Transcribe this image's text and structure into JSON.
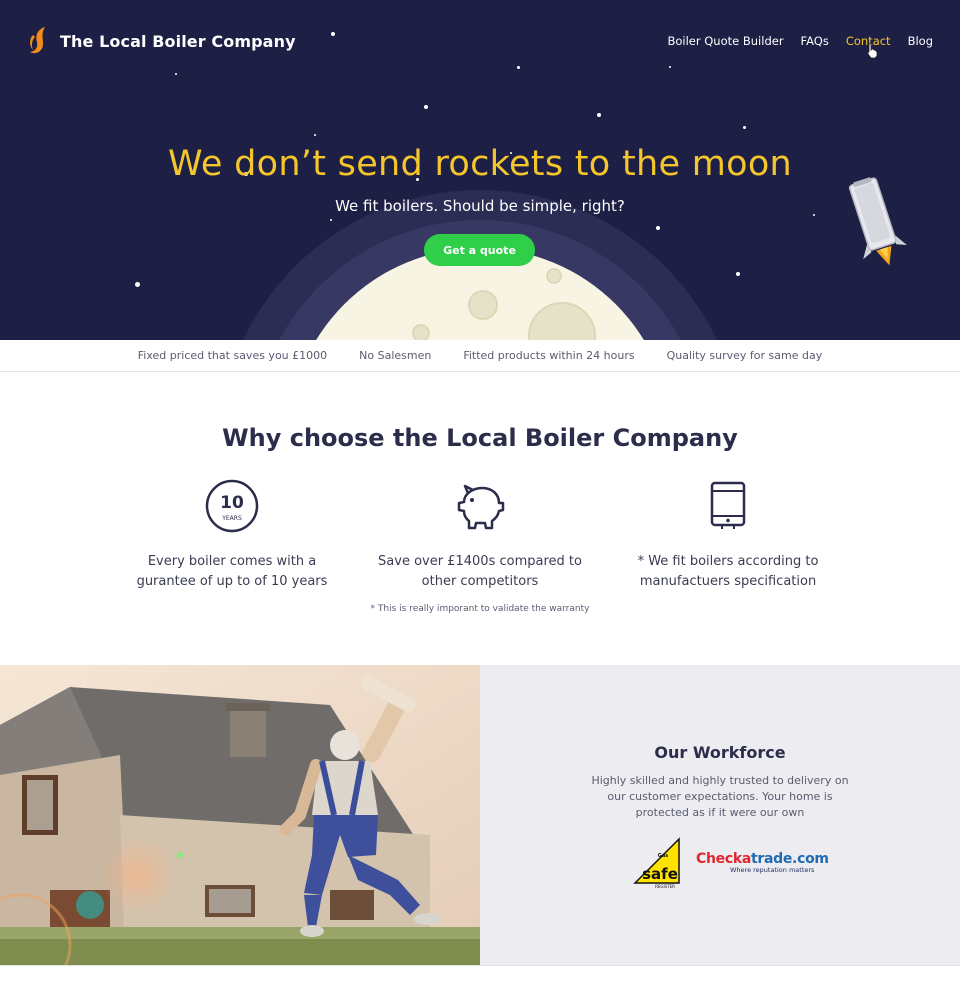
{
  "header": {
    "brand": "The Local Boiler Company",
    "nav": [
      "Boiler Quote Builder",
      "FAQs",
      "Contact",
      "Blog"
    ],
    "active_nav": "Contact"
  },
  "hero": {
    "title": "We don’t send rockets to the moon",
    "subtitle": "We fit boilers. Should be simple, right?",
    "cta": "Get a quote"
  },
  "usps": [
    "Fixed priced that saves you £1000",
    "No Salesmen",
    "Fitted products within 24 hours",
    "Quality survey for same day"
  ],
  "why": {
    "title": "Why choose the Local Boiler Company",
    "badge_number": "10",
    "badge_unit": "YEARS",
    "features": [
      {
        "icon": "ten-years-badge-icon",
        "text": "Every boiler comes with a gurantee of up to of 10 years"
      },
      {
        "icon": "piggy-bank-icon",
        "text": "Save over £1400s compared to other competitors"
      },
      {
        "icon": "boiler-unit-icon",
        "text": "* We fit boilers according to manufactuers specification"
      }
    ],
    "note": "* This is really imporant to validate the warranty"
  },
  "workforce": {
    "title": "Our Workforce",
    "text": "Highly skilled and highly trusted to delivery on our customer expectations. Your home is protected as if it were our own",
    "gas_safe_top": "Gas",
    "gas_safe_word": "safe",
    "gas_safe_bottom": "REGISTER",
    "checkatrade_red": "Checka",
    "checkatrade_blue": "trade.com",
    "checkatrade_tagline": "Where reputation matters"
  },
  "colors": {
    "hero_bg": "#1e1f45",
    "accent_yellow": "#f4c62c",
    "cta_green": "#2fcf4a",
    "panel_grey": "#ececf1"
  }
}
